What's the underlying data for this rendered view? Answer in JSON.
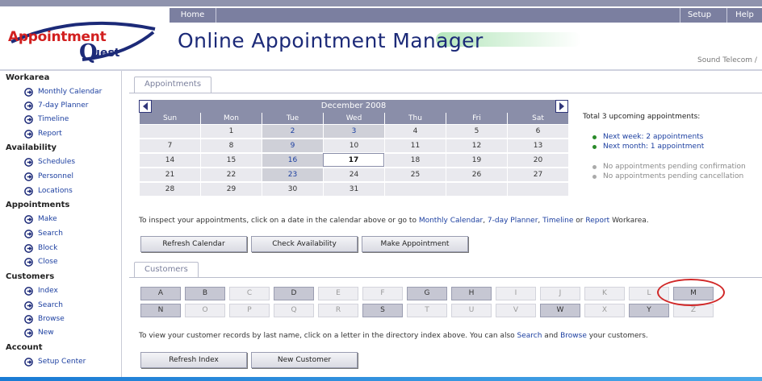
{
  "app": {
    "logo_line1": "Appointment",
    "logo_line2": "uest",
    "title": "Online Appointment Manager",
    "org": "Sound Telecom /"
  },
  "nav": {
    "home": "Home",
    "setup": "Setup",
    "help": "Help"
  },
  "sidebar": {
    "workarea": {
      "heading": "Workarea",
      "items": [
        "Monthly Calendar",
        "7-day Planner",
        "Timeline",
        "Report"
      ]
    },
    "availability": {
      "heading": "Availability",
      "items": [
        "Schedules",
        "Personnel",
        "Locations"
      ]
    },
    "appointments": {
      "heading": "Appointments",
      "items": [
        "Make",
        "Search",
        "Block",
        "Close"
      ]
    },
    "customers": {
      "heading": "Customers",
      "items": [
        "Index",
        "Search",
        "Browse",
        "New"
      ]
    },
    "account": {
      "heading": "Account",
      "items": [
        "Setup Center"
      ]
    }
  },
  "appointments_tab": "Appointments",
  "customers_tab": "Customers",
  "calendar": {
    "month": "December 2008",
    "weekdays": [
      "Sun",
      "Mon",
      "Tue",
      "Wed",
      "Thu",
      "Fri",
      "Sat"
    ],
    "weeks": [
      [
        "",
        "1",
        "2",
        "3",
        "4",
        "5",
        "6"
      ],
      [
        "7",
        "8",
        "9",
        "10",
        "11",
        "12",
        "13"
      ],
      [
        "14",
        "15",
        "16",
        "17",
        "18",
        "19",
        "20"
      ],
      [
        "21",
        "22",
        "23",
        "24",
        "25",
        "26",
        "27"
      ],
      [
        "28",
        "29",
        "30",
        "31",
        "",
        "",
        ""
      ]
    ]
  },
  "upcoming": {
    "total": "Total 3 upcoming appointments:",
    "next_week": "Next week: 2 appointments",
    "next_month": "Next month: 1 appointment",
    "pending_conf": "No appointments pending confirmation",
    "pending_cancel": "No appointments pending cancellation"
  },
  "inspect": {
    "prefix": "To inspect your appointments, click on a date in the calendar above or go to ",
    "l1": "Monthly Calendar",
    "c1": ", ",
    "l2": "7-day Planner",
    "c2": ", ",
    "l3": "Timeline",
    "c3": " or ",
    "l4": "Report",
    "suffix": " Workarea."
  },
  "buttons": {
    "refresh_calendar": "Refresh Calendar",
    "check_availability": "Check Availability",
    "make_appointment": "Make Appointment",
    "refresh_index": "Refresh Index",
    "new_customer": "New Customer"
  },
  "letters_row1": [
    "A",
    "B",
    "C",
    "D",
    "E",
    "F",
    "G",
    "H",
    "I",
    "J",
    "K",
    "L",
    "M"
  ],
  "letters_row2": [
    "N",
    "O",
    "P",
    "Q",
    "R",
    "S",
    "T",
    "U",
    "V",
    "W",
    "X",
    "Y",
    "Z"
  ],
  "view": {
    "prefix": "To view your customer records by last name, click on a letter in the directory index above. You can also ",
    "search": "Search",
    "and": " and ",
    "browse": "Browse",
    "suffix": " your customers."
  }
}
